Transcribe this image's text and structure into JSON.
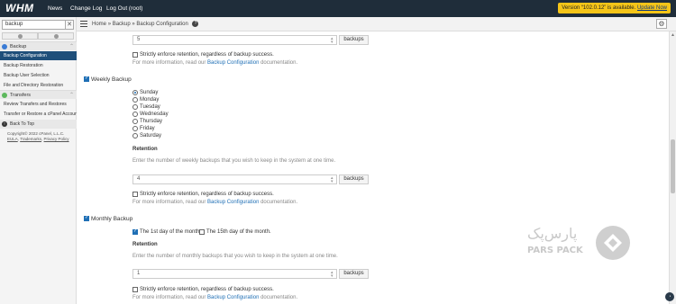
{
  "header": {
    "logo": "WHM",
    "nav": [
      "News",
      "Change Log",
      "Log Out (root)"
    ],
    "notice_prefix": "Version “102.0.12” is available. ",
    "notice_link": "Update Now"
  },
  "sidebar": {
    "search_value": "backup",
    "clear_label": "✕",
    "categories": [
      {
        "label": "Backup",
        "items": [
          "Backup Configuration",
          "Backup Restoration",
          "Backup User Selection",
          "File and Directory Restoration"
        ]
      },
      {
        "label": "Transfers",
        "items": [
          "Review Transfers and Restores",
          "Transfer or Restore a cPanel Account"
        ]
      }
    ],
    "back_to_top": "Back To Top",
    "copyright": "Copyright© 2022 cPanel, L.L.C.",
    "footer_links": [
      "EULA",
      "Trademarks",
      "Privacy Policy"
    ]
  },
  "breadcrumb": {
    "home": "Home",
    "section": "Backup",
    "page": "Backup Configuration",
    "sep": "»"
  },
  "daily": {
    "retention_value": "5",
    "addon": "backups",
    "strict_label": "Strictly enforce retention, regardless of backup success.",
    "info_prefix": "For more information, read our ",
    "info_link": "Backup Configuration",
    "info_suffix": " documentation."
  },
  "weekly": {
    "label": "Weekly Backup",
    "days": [
      "Sunday",
      "Monday",
      "Tuesday",
      "Wednesday",
      "Thursday",
      "Friday",
      "Saturday"
    ],
    "selected_day": "Sunday",
    "retention_title": "Retention",
    "retention_help": "Enter the number of weekly backups that you wish to keep in the system at one time.",
    "retention_value": "4",
    "addon": "backups",
    "strict_label": "Strictly enforce retention, regardless of backup success.",
    "info_prefix": "For more information, read our ",
    "info_link": "Backup Configuration",
    "info_suffix": " documentation."
  },
  "monthly": {
    "label": "Monthly Backup",
    "opt1": "The 1st day of the month.",
    "opt2": "The 15th day of the month.",
    "retention_title": "Retention",
    "retention_help": "Enter the number of monthly backups that you wish to keep in the system at one time.",
    "retention_value": "1",
    "addon": "backups",
    "strict_label": "Strictly enforce retention, regardless of backup success.",
    "info_prefix": "For more information, read our ",
    "info_link": "Backup Configuration",
    "info_suffix": " documentation."
  },
  "watermark": {
    "brand": "PARS PACK",
    "brand_fa": "پارس‌پک"
  },
  "colors": {
    "topbar": "#1f2d3a",
    "notice": "#f5c518",
    "active": "#1f4f7a",
    "link": "#1f6fb5"
  }
}
